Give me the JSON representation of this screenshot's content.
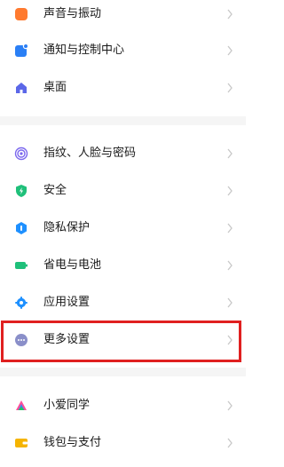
{
  "settings": {
    "items": [
      {
        "label": "声音与振动",
        "icon": "sound-vibration-icon",
        "color": "#ff7a2f"
      },
      {
        "label": "通知与控制中心",
        "icon": "notification-icon",
        "color": "#2a7ff5"
      },
      {
        "label": "桌面",
        "icon": "home-icon",
        "color": "#5b67e8"
      },
      {
        "label": "指纹、人脸与密码",
        "icon": "fingerprint-icon",
        "color": "#7b68ee"
      },
      {
        "label": "安全",
        "icon": "shield-icon",
        "color": "#1fc07a"
      },
      {
        "label": "隐私保护",
        "icon": "privacy-icon",
        "color": "#1e90ff"
      },
      {
        "label": "省电与电池",
        "icon": "battery-icon",
        "color": "#1fc07a"
      },
      {
        "label": "应用设置",
        "icon": "gear-icon",
        "color": "#1e90ff"
      },
      {
        "label": "更多设置",
        "icon": "more-icon",
        "color": "#8a8fc9"
      },
      {
        "label": "小爱同学",
        "icon": "xiaoai-icon",
        "color": "#ff4f9a"
      },
      {
        "label": "钱包与支付",
        "icon": "wallet-icon",
        "color": "#f5b400"
      }
    ]
  }
}
